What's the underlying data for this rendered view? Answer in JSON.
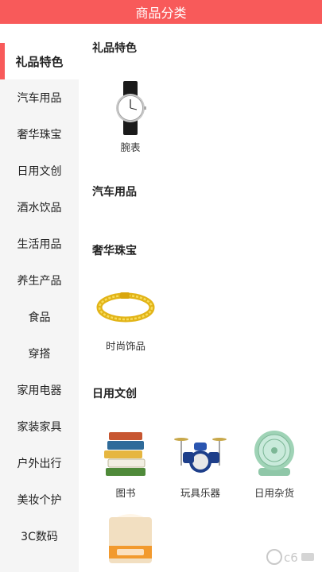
{
  "header": {
    "title": "商品分类"
  },
  "sidebar": {
    "items": [
      {
        "label": "礼品特色",
        "active": true
      },
      {
        "label": "汽车用品"
      },
      {
        "label": "奢华珠宝"
      },
      {
        "label": "日用文创"
      },
      {
        "label": "酒水饮品"
      },
      {
        "label": "生活用品"
      },
      {
        "label": "养生产品"
      },
      {
        "label": "食品"
      },
      {
        "label": "穿搭"
      },
      {
        "label": "家用电器"
      },
      {
        "label": "家装家具"
      },
      {
        "label": "户外出行"
      },
      {
        "label": "美妆个护"
      },
      {
        "label": "3C数码"
      }
    ]
  },
  "content": {
    "sections": [
      {
        "title": "礼品特色",
        "products": [
          {
            "label": "腕表",
            "icon": "watch-icon"
          }
        ]
      },
      {
        "title": "汽车用品",
        "products": []
      },
      {
        "title": "奢华珠宝",
        "products": [
          {
            "label": "时尚饰品",
            "icon": "gold-bracelet-icon"
          }
        ]
      },
      {
        "title": "日用文创",
        "products": [
          {
            "label": "图书",
            "icon": "books-icon"
          },
          {
            "label": "玩具乐器",
            "icon": "drum-kit-icon"
          },
          {
            "label": "日用杂货",
            "icon": "desk-fan-icon"
          },
          {
            "label": "",
            "icon": "tissue-box-icon"
          }
        ]
      }
    ]
  },
  "theme": {
    "accent": "#f85a5a",
    "sidebar_bg": "#f5f5f5"
  }
}
